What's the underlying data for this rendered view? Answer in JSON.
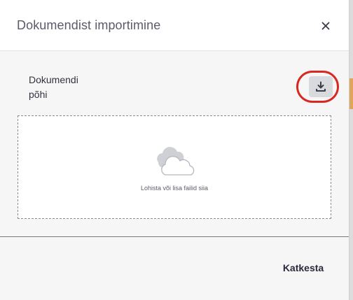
{
  "dialog": {
    "title": "Dokumendist importimine",
    "close_icon": "close-icon"
  },
  "template_section": {
    "label": "Dokumendi põhi",
    "download_icon": "download-icon"
  },
  "dropzone": {
    "text": "Lohista või lisa failid siia",
    "icon": "cloud-upload-icon"
  },
  "footer": {
    "cancel_label": "Katkesta"
  },
  "colors": {
    "highlight": "#d8281f",
    "dialog_bg": "#f6f6f7",
    "header_bg": "#ffffff"
  }
}
